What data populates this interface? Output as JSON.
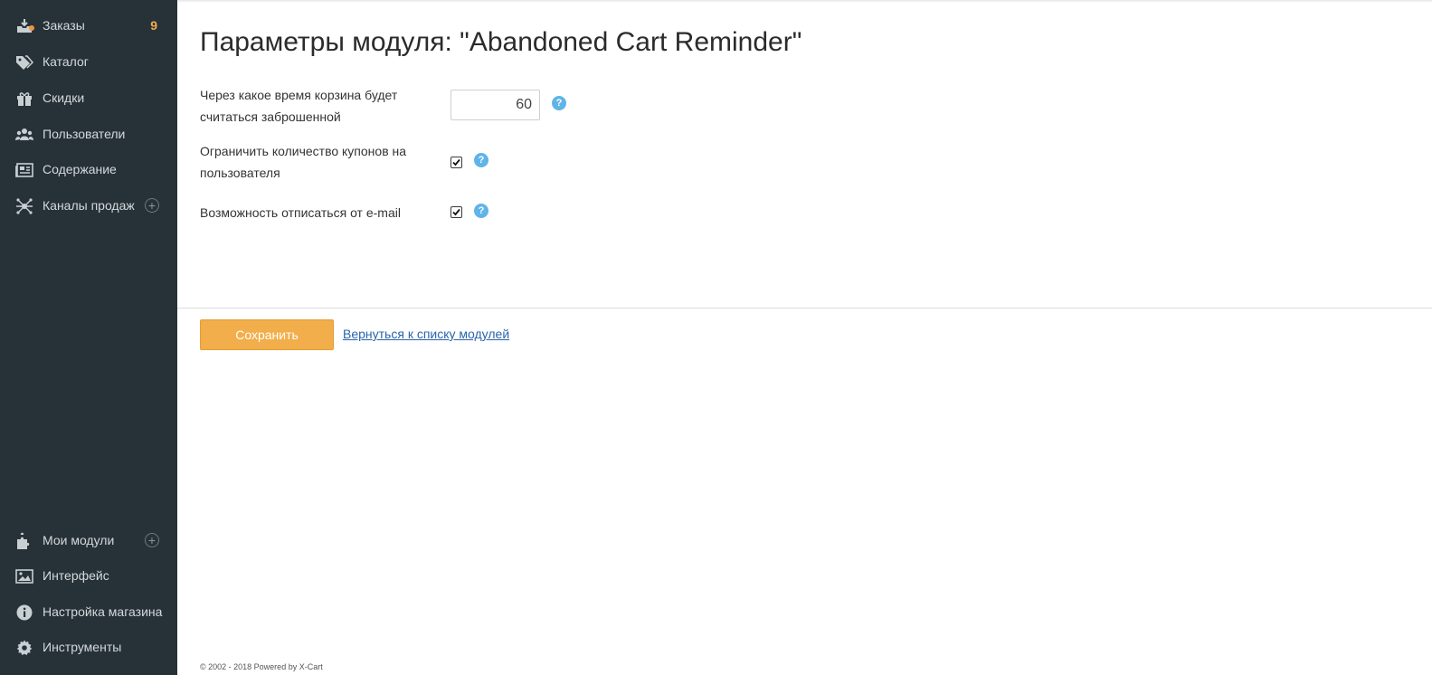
{
  "sidebar": {
    "items": [
      {
        "label": "Заказы",
        "count": "9"
      },
      {
        "label": "Каталог"
      },
      {
        "label": "Скидки"
      },
      {
        "label": "Пользователи"
      },
      {
        "label": "Содержание"
      },
      {
        "label": "Каналы продаж"
      }
    ],
    "bottom_items": [
      {
        "label": "Мои модули"
      },
      {
        "label": "Интерфейс"
      },
      {
        "label": "Настройка магазина"
      },
      {
        "label": "Инструменты"
      }
    ],
    "plus_symbol": "+"
  },
  "main": {
    "title": "Параметры модуля: \"Abandoned Cart Reminder\"",
    "fields": [
      {
        "label": "Через какое время корзина будет считаться заброшенной",
        "value": "60"
      },
      {
        "label": "Ограничить количество купонов на пользователя",
        "checked": true
      },
      {
        "label": "Возможность отписаться от e-mail",
        "checked": true
      }
    ],
    "help_symbol": "?",
    "save_label": "Сохранить",
    "back_link": "Вернуться к списку модулей"
  },
  "footer": {
    "text": "© 2002 - 2018 Powered by X-Cart"
  },
  "colors": {
    "sidebar_bg": "#273238",
    "accent_orange": "#f2ae4a",
    "help_blue": "#5fb4e8",
    "link_blue": "#2a64a8"
  }
}
